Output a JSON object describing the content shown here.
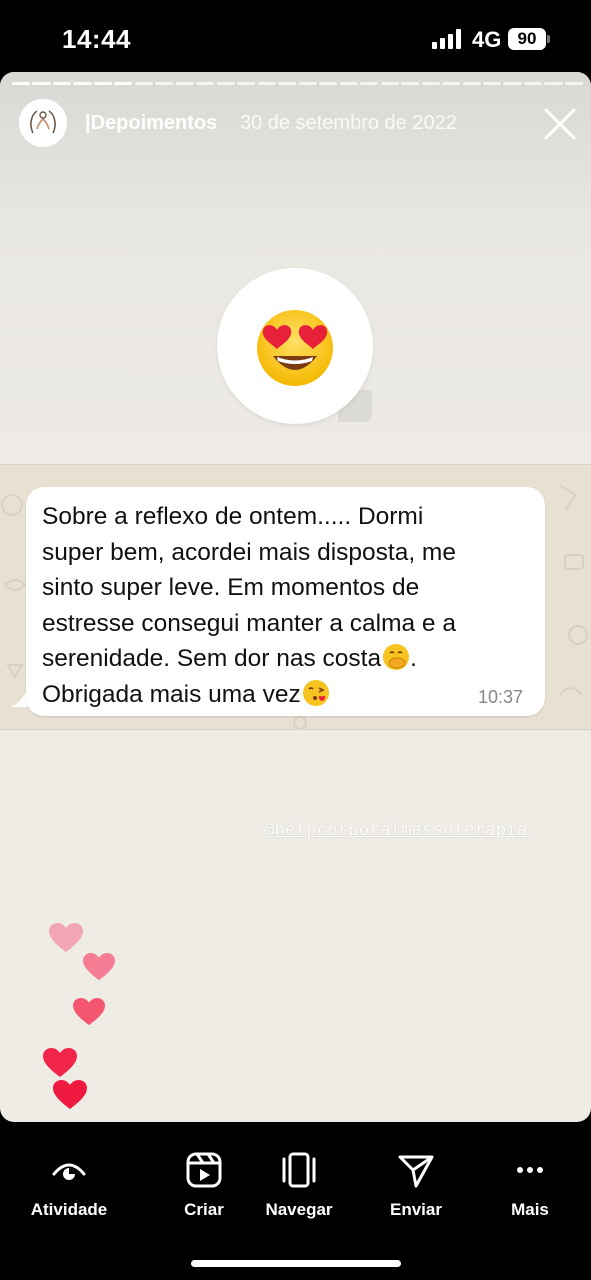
{
  "status_bar": {
    "time": "14:44",
    "network": "4G",
    "battery": "90"
  },
  "story": {
    "account_name": "|Depoimentos",
    "date": "30 de setembro de 2022",
    "progress_segments": 28,
    "reaction_emoji": "heart-eyes-emoji",
    "message": {
      "lines": [
        "Sobre a reflexo de ontem..... Dormi",
        "super bem, acordei mais disposta, me",
        "sinto super leve. Em momentos de",
        "estresse consegui manter a calma e a",
        "serenidade. Sem dor nas costa",
        "Obrigada mais uma vez"
      ],
      "line5_suffix": ".",
      "time": "10:37"
    },
    "mention": "@helpcorporalmassoterapia"
  },
  "bottom_nav": {
    "items": [
      {
        "label": "Atividade",
        "icon": "eye-activity-icon"
      },
      {
        "label": "Criar",
        "icon": "reels-icon"
      },
      {
        "label": "Navegar",
        "icon": "carousel-icon"
      },
      {
        "label": "Enviar",
        "icon": "send-icon"
      },
      {
        "label": "Mais",
        "icon": "more-icon"
      }
    ]
  },
  "colors": {
    "background": "#000000",
    "story_bg": "#efece6",
    "chat_bg": "#e7e0d3",
    "heart": "#ff3355"
  }
}
